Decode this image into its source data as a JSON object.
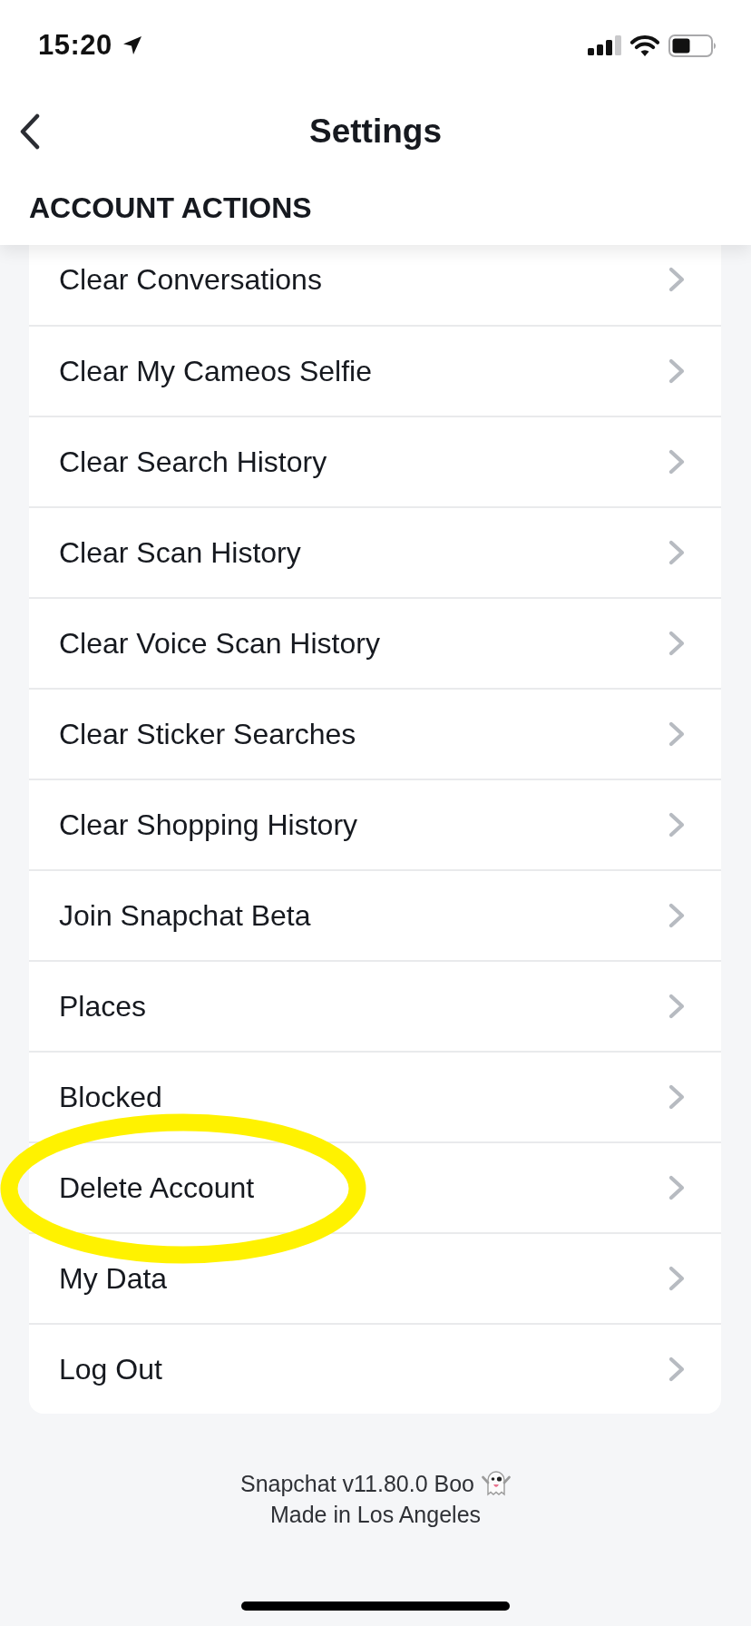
{
  "status_bar": {
    "time": "15:20"
  },
  "header": {
    "title": "Settings"
  },
  "section": {
    "title": "ACCOUNT ACTIONS",
    "rows": [
      {
        "label": "Clear Conversations",
        "circled": false
      },
      {
        "label": "Clear My Cameos Selfie",
        "circled": false
      },
      {
        "label": "Clear Search History",
        "circled": false
      },
      {
        "label": "Clear Scan History",
        "circled": false
      },
      {
        "label": "Clear Voice Scan History",
        "circled": false
      },
      {
        "label": "Clear Sticker Searches",
        "circled": false
      },
      {
        "label": "Clear Shopping History",
        "circled": false
      },
      {
        "label": "Join Snapchat Beta",
        "circled": false
      },
      {
        "label": "Places",
        "circled": false
      },
      {
        "label": "Blocked",
        "circled": false
      },
      {
        "label": "Delete Account",
        "circled": true
      },
      {
        "label": "My Data",
        "circled": false
      },
      {
        "label": "Log Out",
        "circled": false
      }
    ]
  },
  "footer": {
    "version": "Snapchat v11.80.0 Boo",
    "made_in": "Made in Los Angeles"
  }
}
